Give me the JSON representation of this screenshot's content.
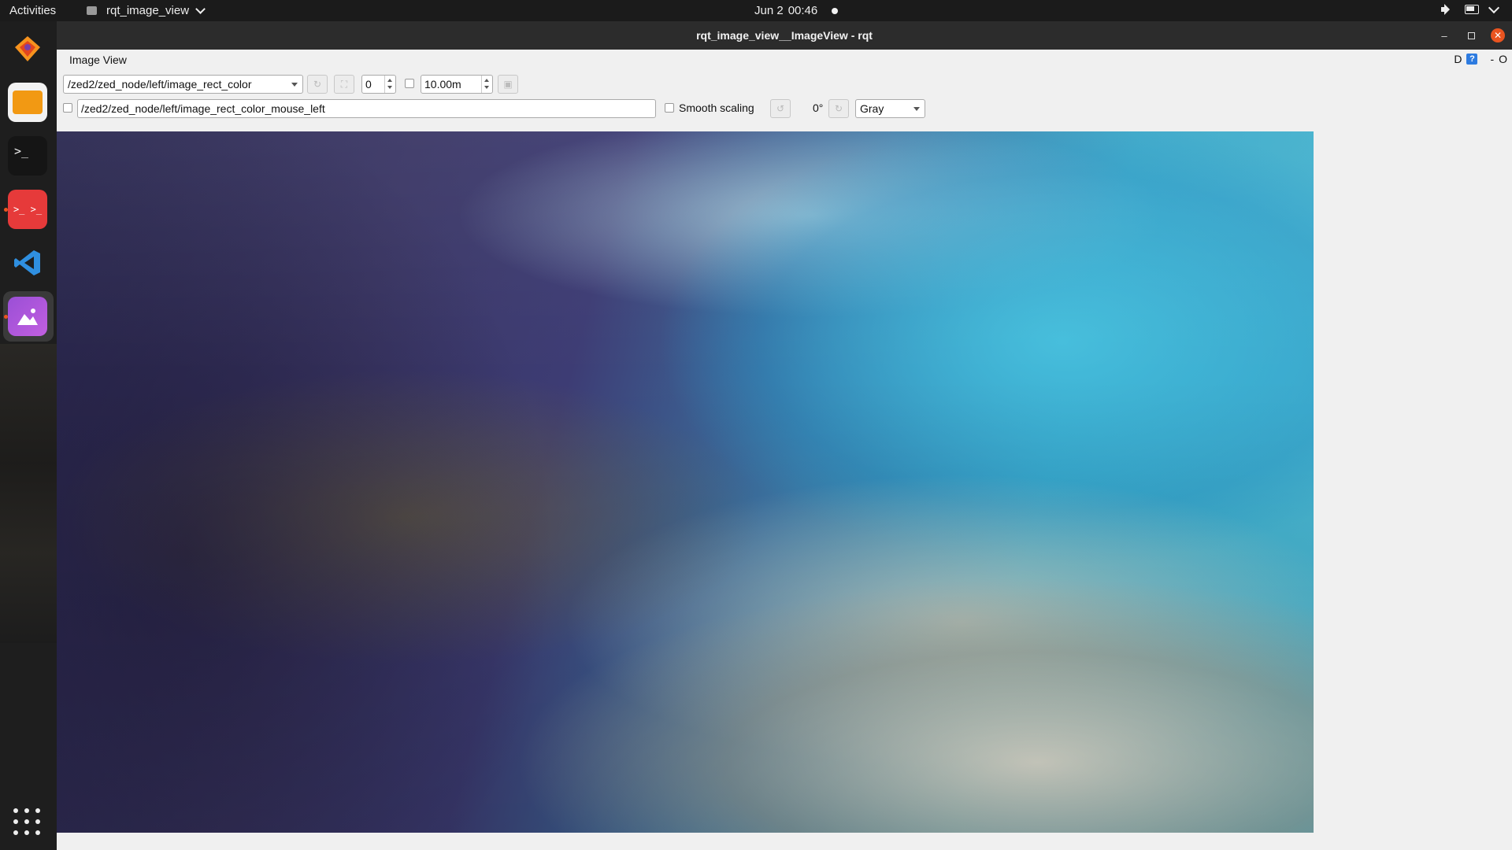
{
  "topbar": {
    "activities": "Activities",
    "app_name": "rqt_image_view",
    "date": "Jun 2",
    "time": "00:46"
  },
  "dock": {
    "items": [
      "gitkraken-icon",
      "files-icon",
      "terminal-icon",
      "terminator-icon",
      "vscode-icon",
      "image-viewer-icon"
    ],
    "show_apps_label": "Show Applications"
  },
  "window": {
    "title": "rqt_image_view__ImageView - rqt",
    "panel_label": "Image View",
    "panel_right_letter": "D",
    "panel_help": "?",
    "panel_minus": "-",
    "panel_close": "O"
  },
  "toolbar": {
    "topic": "/zed2/zed_node/left/image_rect_color",
    "spin_value": "0",
    "max_range": "10.00m",
    "mouse_topic": "/zed2/zed_node/left/image_rect_color_mouse_left",
    "smooth_scaling_label": "Smooth scaling",
    "rotation": "0°",
    "color_scheme": "Gray"
  },
  "colors": {
    "accent": "#e95420",
    "titlebar": "#2c2c2c",
    "window_bg": "#f0f0f0"
  }
}
